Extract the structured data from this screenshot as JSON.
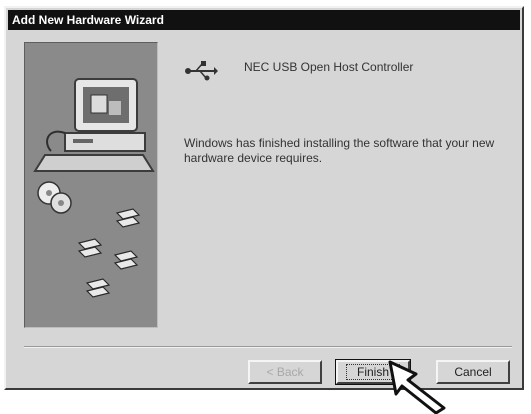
{
  "window": {
    "title": "Add New Hardware Wizard"
  },
  "device": {
    "icon": "usb-icon",
    "name": "NEC USB Open Host Controller"
  },
  "message": "Windows has finished installing the software that your new hardware device requires.",
  "buttons": {
    "back_label": "< Back",
    "finish_label": "Finish",
    "cancel_label": "Cancel"
  },
  "side_panel": {
    "art": "computer-with-cds-illustration"
  },
  "cursor": {
    "icon": "hand-pointer-icon"
  },
  "colors": {
    "dialog_bg": "#d6d6d6",
    "titlebar_bg": "#111111",
    "panel_bg": "#8a8a8a"
  }
}
